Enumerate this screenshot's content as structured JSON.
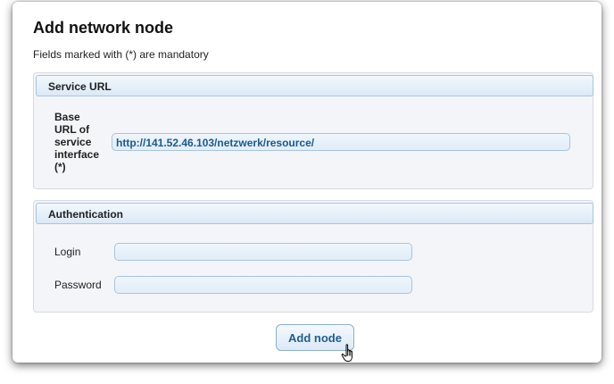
{
  "form": {
    "title": "Add network node",
    "mandatory_note": "Fields marked with (*) are mandatory",
    "submit_label": "Add node"
  },
  "service_url": {
    "legend": "Service URL",
    "base_url_label_lines": [
      "Base",
      "URL of",
      "service",
      "interface",
      "(*)"
    ],
    "base_url_value": "http://141.52.46.103/netzwerk/resource/"
  },
  "authentication": {
    "legend": "Authentication",
    "login_label": "Login",
    "login_value": "",
    "password_label": "Password",
    "password_value": ""
  },
  "colors": {
    "accent": "#1f5d90",
    "input_border": "#a9c4df",
    "fieldset_background": "#f3f5f8"
  },
  "icons": {
    "cursor": "hand-pointer-icon"
  }
}
